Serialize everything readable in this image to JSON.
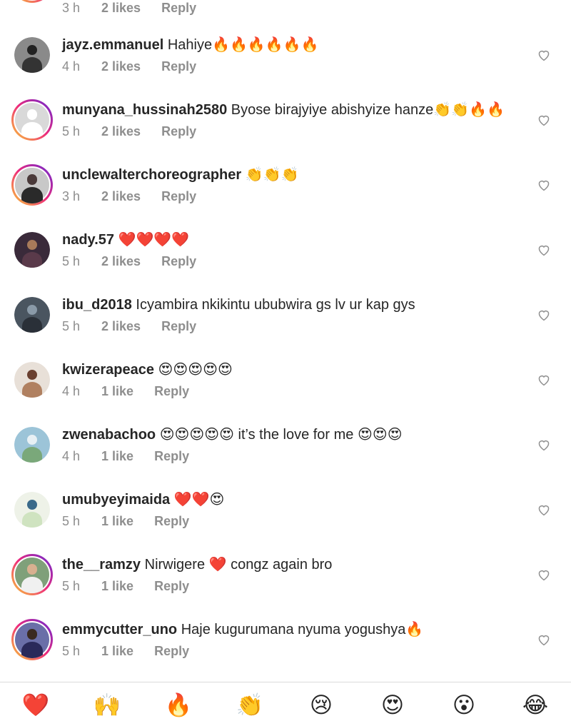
{
  "top_partial": {
    "time": "3 h",
    "likes": "2 likes",
    "reply": "Reply"
  },
  "comments": [
    {
      "username": "jayz.emmanuel",
      "text": "Hahiye🔥🔥🔥🔥🔥🔥",
      "time": "4 h",
      "likes": "2 likes",
      "reply": "Reply",
      "avatar_color": "#8a8a8a",
      "ring": false
    },
    {
      "username": "munyana_hussinah2580",
      "text": "Byose birajyiye abishyize hanze👏👏🔥🔥",
      "time": "5 h",
      "likes": "2 likes",
      "reply": "Reply",
      "avatar_color": "#d9d9d9",
      "ring": true
    },
    {
      "username": "unclewalterchoreographer",
      "text": "👏👏👏",
      "time": "3 h",
      "likes": "2 likes",
      "reply": "Reply",
      "avatar_color": "#6b6b6b",
      "ring": true
    },
    {
      "username": "nady.57",
      "text": "❤️❤️❤️❤️",
      "time": "5 h",
      "likes": "2 likes",
      "reply": "Reply",
      "avatar_color": "#3a2a3a",
      "ring": false
    },
    {
      "username": "ibu_d2018",
      "text": "Icyambira nkikintu ububwira gs  lv ur kap gys",
      "time": "5 h",
      "likes": "2 likes",
      "reply": "Reply",
      "avatar_color": "#4a5560",
      "ring": false
    },
    {
      "username": "kwizerapeace",
      "text": "😍😍😍😍😍",
      "time": "4 h",
      "likes": "1 like",
      "reply": "Reply",
      "avatar_color": "#b08060",
      "ring": false
    },
    {
      "username": "zwenabachoo",
      "text": "😍😍😍😍😍 it’s the love for me 😍😍😍",
      "time": "4 h",
      "likes": "1 like",
      "reply": "Reply",
      "avatar_color": "#9cc4d8",
      "ring": false
    },
    {
      "username": "umubyeyimaida",
      "text": "❤️❤️😍",
      "time": "5 h",
      "likes": "1 like",
      "reply": "Reply",
      "avatar_color": "#cfe3c0",
      "ring": false
    },
    {
      "username": "the__ramzy",
      "text": "Nirwigere ❤️ congz again bro",
      "time": "5 h",
      "likes": "1 like",
      "reply": "Reply",
      "avatar_color": "#7fa07a",
      "ring": true
    },
    {
      "username": "emmycutter_uno",
      "text": "Haje kugurumana nyuma yogushya🔥",
      "time": "5 h",
      "likes": "1 like",
      "reply": "Reply",
      "avatar_color": "#6a6fa8",
      "ring": true
    }
  ],
  "emoji_bar": [
    "❤️",
    "🙌",
    "🔥",
    "👏",
    "😢",
    "😍",
    "😮",
    "😂"
  ],
  "colors": {
    "meta": "#8e8e8e",
    "text": "#262626",
    "divider": "#dbdbdb"
  }
}
